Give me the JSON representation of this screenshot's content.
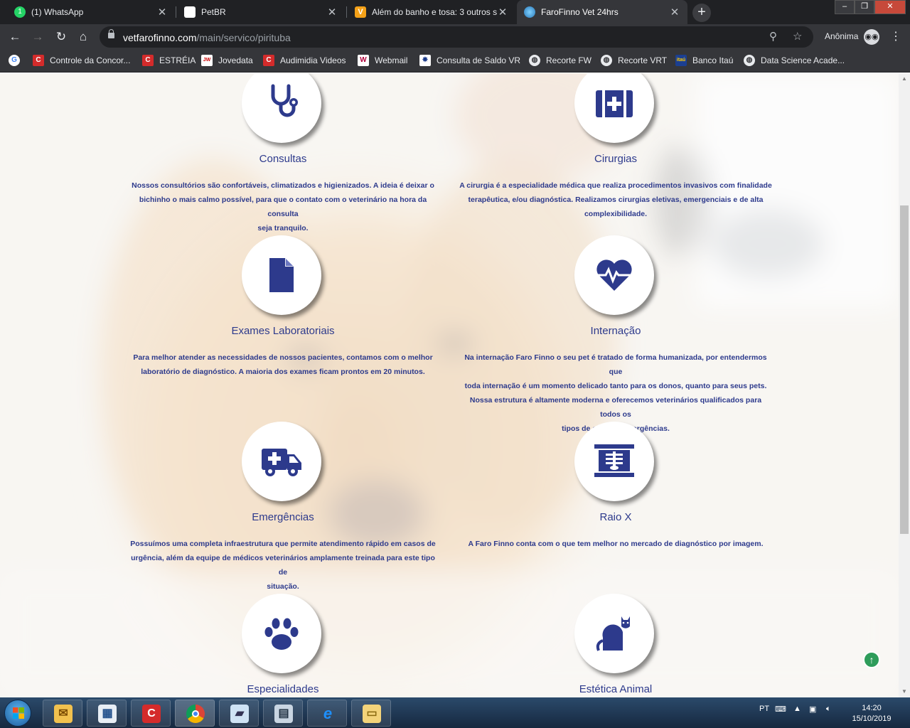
{
  "browser": {
    "tabs": [
      {
        "title": "(1) WhatsApp",
        "favicon": "whatsapp-icon",
        "color": "#25d366"
      },
      {
        "title": "PetBR",
        "favicon": "blank-page-icon",
        "color": "#ffffff"
      },
      {
        "title": "Além do banho e tosa: 3 outros s",
        "favicon": "v-logo-icon",
        "color": "#f4a118"
      },
      {
        "title": "FaroFinno Vet 24hrs",
        "favicon": "globe-icon",
        "color": "#3aa0d8"
      }
    ],
    "new_tab": "+",
    "url_domain": "vetfarofinno.com",
    "url_path": "/main/servico/pirituba",
    "profile_label": "Anônima"
  },
  "bookmarks": [
    {
      "label": "Controle da Concor...",
      "icon": "c-red-icon"
    },
    {
      "label": "ESTRÉIA",
      "icon": "c-red-icon"
    },
    {
      "label": "Jovedata",
      "icon": "jovedata-icon"
    },
    {
      "label": "Audimidia Videos",
      "icon": "c-red-icon"
    },
    {
      "label": "Webmail",
      "icon": "w-icon"
    },
    {
      "label": "Consulta de Saldo VR",
      "icon": "vr-star-icon"
    },
    {
      "label": "Recorte FW",
      "icon": "globe-icon"
    },
    {
      "label": "Recorte VRT",
      "icon": "globe-icon"
    },
    {
      "label": "Banco Itaú",
      "icon": "itau-icon"
    },
    {
      "label": "Data Science Acade...",
      "icon": "globe-icon"
    }
  ],
  "services": [
    {
      "title": "Consultas",
      "icon": "stethoscope-icon",
      "desc": [
        "Nossos consultórios são confortáveis, climatizados e higienizados. A ideia é deixar o",
        "bichinho o mais calmo possível, para que o contato com o veterinário na hora da consulta",
        "seja tranquilo."
      ]
    },
    {
      "title": "Cirurgias",
      "icon": "medical-kit-icon",
      "desc": [
        "A cirurgia é a especialidade médica que realiza procedimentos invasivos com finalidade",
        "terapêutica, e/ou diagnóstica. Realizamos cirurgias eletivas, emergenciais e de alta",
        "complexibilidade."
      ]
    },
    {
      "title": "Exames Laboratoriais",
      "icon": "document-icon",
      "desc": [
        "Para melhor atender as necessidades de nossos pacientes, contamos com o melhor",
        "laboratório de diagnóstico. A maioria dos exames ficam prontos em 20 minutos."
      ]
    },
    {
      "title": "Internação",
      "icon": "heartbeat-icon",
      "desc": [
        "Na internação Faro Finno o seu pet é tratado de forma humanizada, por entendermos que",
        "toda internação é um momento delicado tanto para os donos, quanto para seus pets.",
        "Nossa estrutura é altamente moderna e oferecemos veterinários qualificados para todos os",
        "tipos de casos e emergências."
      ]
    },
    {
      "title": "Emergências",
      "icon": "ambulance-icon",
      "desc": [
        "Possuímos uma completa infraestrutura que permite atendimento rápido em casos de",
        "urgência, além da equipe de médicos veterinários amplamente treinada para este tipo de",
        "situação."
      ]
    },
    {
      "title": "Raio X",
      "icon": "x-ray-icon",
      "desc": [
        "A Faro Finno conta com o que tem melhor no mercado de diagnóstico por imagem."
      ]
    },
    {
      "title": "Especialidades",
      "icon": "paw-icon",
      "desc": []
    },
    {
      "title": "Estética Animal",
      "icon": "cat-icon",
      "desc": []
    }
  ],
  "colors": {
    "accent": "#2d3a8c",
    "back_to_top": "#2e9c5a"
  },
  "taskbar": {
    "apps": [
      "outlook-icon",
      "screen-icon",
      "c-red-icon",
      "chrome-icon",
      "notes-icon",
      "calculator-icon",
      "ie-icon",
      "explorer-icon"
    ],
    "language": "PT",
    "time": "14:20",
    "date": "15/10/2019"
  }
}
